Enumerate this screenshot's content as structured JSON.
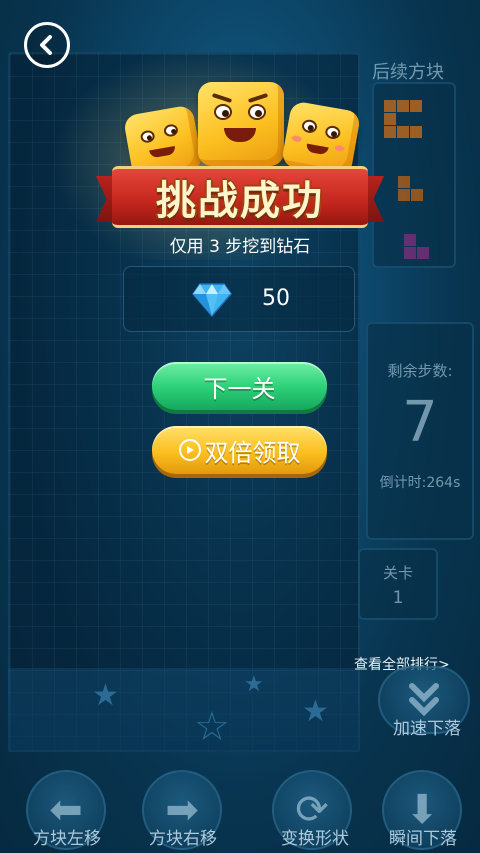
{
  "header": {
    "back_icon": "chevron-left-icon"
  },
  "side": {
    "next_pieces_label": "后续方块",
    "steps_label": "剩余步数:",
    "steps_value": "7",
    "countdown_label": "倒计时:264s",
    "level_label": "关卡",
    "level_value": "1",
    "ranking_link": "查看全部排行>",
    "speed_drop_label": "加速下落"
  },
  "dialog": {
    "title": "挑战成功",
    "subtitle": "仅用 3 步挖到钻石",
    "reward_icon": "diamond-icon",
    "reward_amount": "50",
    "next_button": "下一关",
    "double_button": "双倍领取"
  },
  "controls": [
    {
      "label": "方块左移",
      "icon": "arrow-left-icon"
    },
    {
      "label": "方块右移",
      "icon": "arrow-right-icon"
    },
    {
      "label": "变换形状",
      "icon": "rotate-icon"
    },
    {
      "label": "瞬间下落",
      "icon": "arrow-down-icon"
    }
  ],
  "colors": {
    "next_button": "#2fd27a",
    "double_button": "#fbbf20",
    "ribbon": "#c4261e",
    "piece_orange": "#c06a1c",
    "piece_purple": "#7a2f7c"
  }
}
